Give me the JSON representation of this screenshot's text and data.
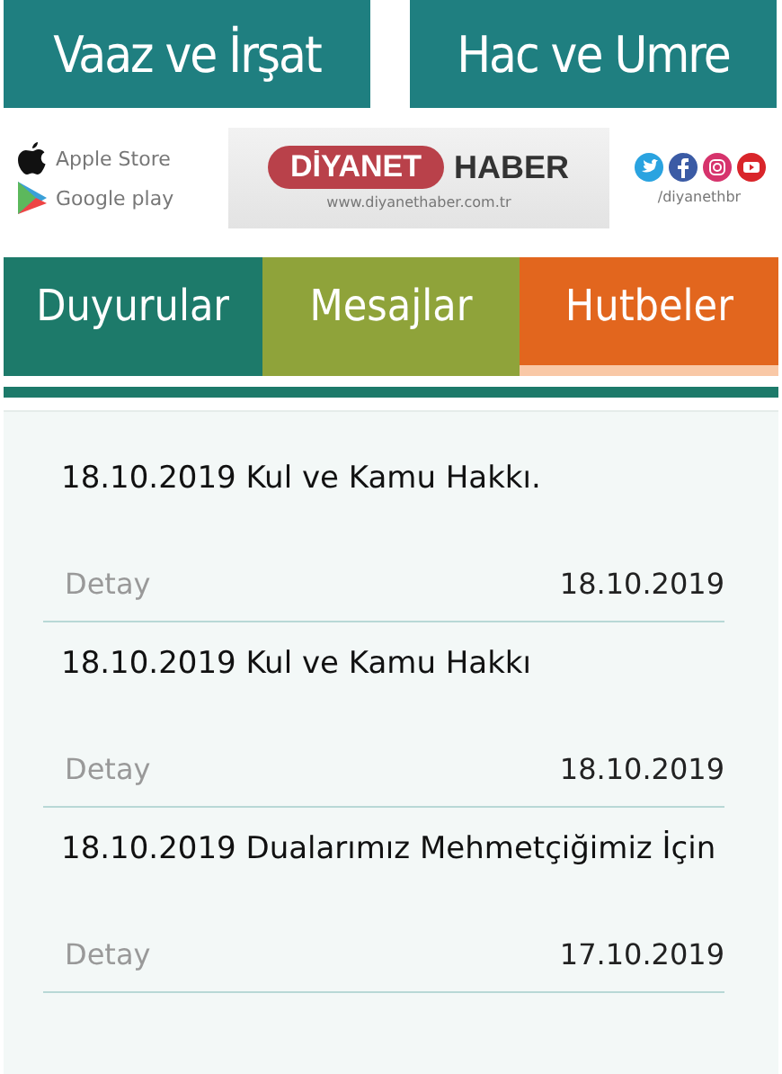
{
  "top_buttons": [
    "Vaaz ve İrşat",
    "Hac ve Umre"
  ],
  "banner": {
    "stores": [
      {
        "kind": "apple",
        "label": "Apple Store"
      },
      {
        "kind": "google",
        "label": "Google play"
      }
    ],
    "logo": {
      "left": "DİYANET",
      "right": "HABER",
      "url": "www.diyanethaber.com.tr"
    },
    "social": {
      "handle": "/diyanethbr"
    }
  },
  "tabs": [
    {
      "label": "Duyurular",
      "color": "#1d7a6a",
      "selected": false
    },
    {
      "label": "Mesajlar",
      "color": "#8fa33a",
      "selected": false
    },
    {
      "label": "Hutbeler",
      "color": "#e2661e",
      "selected": true
    }
  ],
  "items": [
    {
      "title": "18.10.2019 Kul ve Kamu Hakkı.",
      "link": "Detay",
      "date": "18.10.2019"
    },
    {
      "title": "18.10.2019 Kul ve Kamu Hakkı",
      "link": "Detay",
      "date": "18.10.2019"
    },
    {
      "title": "18.10.2019 Dualarımız Mehmetçiğimiz İçin",
      "link": "Detay",
      "date": "17.10.2019"
    }
  ]
}
